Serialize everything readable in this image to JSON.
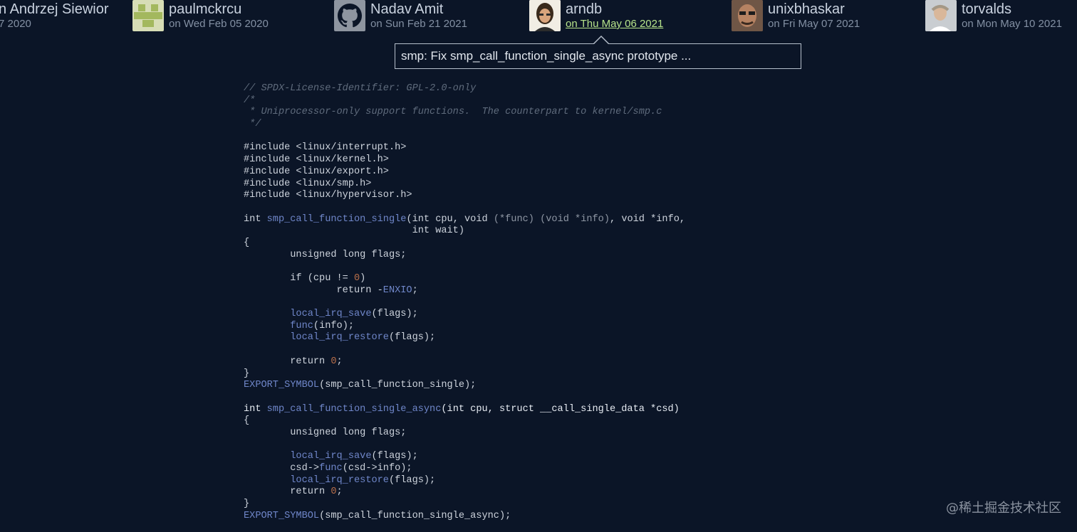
{
  "authors": [
    {
      "name": "n Andrzej Siewior",
      "date": "7 2020",
      "avatar": "none"
    },
    {
      "name": "paulmckrcu",
      "date": "on Wed Feb 05 2020",
      "avatar": "identicon"
    },
    {
      "name": "Nadav Amit",
      "date": "on Sun Feb 21 2021",
      "avatar": "github-icon"
    },
    {
      "name": "arndb",
      "date": "on Thu May 06 2021",
      "avatar": "photo",
      "active": true
    },
    {
      "name": "unixbhaskar",
      "date": "on Fri May 07 2021",
      "avatar": "photo"
    },
    {
      "name": "torvalds",
      "date": "on Mon May 10 2021",
      "avatar": "photo"
    }
  ],
  "tooltip": {
    "text": "smp: Fix smp_call_function_single_async prototype ..."
  },
  "code": [
    [
      [
        "com",
        "// SPDX-License-Identifier: GPL-2.0-only"
      ]
    ],
    [
      [
        "com",
        "/*"
      ]
    ],
    [
      [
        "com",
        " * Uniprocessor-only support functions.  The counterpart to kernel/smp.c"
      ]
    ],
    [
      [
        "com",
        " */"
      ]
    ],
    [],
    [
      [
        "",
        "#include <linux/interrupt.h>"
      ]
    ],
    [
      [
        "",
        "#include <linux/kernel.h>"
      ]
    ],
    [
      [
        "",
        "#include <linux/export.h>"
      ]
    ],
    [
      [
        "",
        "#include <linux/smp.h>"
      ]
    ],
    [
      [
        "",
        "#include <linux/hypervisor.h>"
      ]
    ],
    [],
    [
      [
        "",
        "int "
      ],
      [
        "fn",
        "smp_call_function_single"
      ],
      [
        "",
        "(int cpu, void "
      ],
      [
        "dim",
        "(*func)"
      ],
      [
        "",
        " "
      ],
      [
        "dim",
        "(void *info)"
      ],
      [
        "",
        ", void *info,"
      ]
    ],
    [
      [
        "",
        "                             int wait)"
      ]
    ],
    [
      [
        "",
        "{"
      ]
    ],
    [
      [
        "",
        "        unsigned long flags;"
      ]
    ],
    [],
    [
      [
        "",
        "        if (cpu != "
      ],
      [
        "num",
        "0"
      ],
      [
        "",
        ")"
      ]
    ],
    [
      [
        "",
        "                return -"
      ],
      [
        "fn",
        "ENXIO"
      ],
      [
        "",
        ";"
      ]
    ],
    [],
    [
      [
        "",
        "        "
      ],
      [
        "fn",
        "local_irq_save"
      ],
      [
        "",
        "(flags);"
      ]
    ],
    [
      [
        "",
        "        "
      ],
      [
        "fn",
        "func"
      ],
      [
        "",
        "(info);"
      ]
    ],
    [
      [
        "",
        "        "
      ],
      [
        "fn",
        "local_irq_restore"
      ],
      [
        "",
        "(flags);"
      ]
    ],
    [],
    [
      [
        "",
        "        return "
      ],
      [
        "num",
        "0"
      ],
      [
        "",
        ";"
      ]
    ],
    [
      [
        "",
        "}"
      ]
    ],
    [
      [
        "fn",
        "EXPORT_SYMBOL"
      ],
      [
        "",
        "(smp_call_function_single);"
      ]
    ],
    [],
    [
      [
        "hl",
        "int "
      ],
      [
        "fn",
        "smp_call_function_single_async"
      ],
      [
        "hl",
        "(int cpu, struct __call_single_data *csd)"
      ]
    ],
    [
      [
        "",
        "{"
      ]
    ],
    [
      [
        "",
        "        unsigned long flags;"
      ]
    ],
    [],
    [
      [
        "",
        "        "
      ],
      [
        "fn",
        "local_irq_save"
      ],
      [
        "",
        "(flags);"
      ]
    ],
    [
      [
        "",
        "        csd->"
      ],
      [
        "fn",
        "func"
      ],
      [
        "",
        "(csd->info);"
      ]
    ],
    [
      [
        "",
        "        "
      ],
      [
        "fn",
        "local_irq_restore"
      ],
      [
        "",
        "(flags);"
      ]
    ],
    [
      [
        "",
        "        return "
      ],
      [
        "num",
        "0"
      ],
      [
        "",
        ";"
      ]
    ],
    [
      [
        "",
        "}"
      ]
    ],
    [
      [
        "fn",
        "EXPORT_SYMBOL"
      ],
      [
        "",
        "(smp_call_function_single_async);"
      ]
    ]
  ],
  "watermark": "@稀土掘金技术社区"
}
